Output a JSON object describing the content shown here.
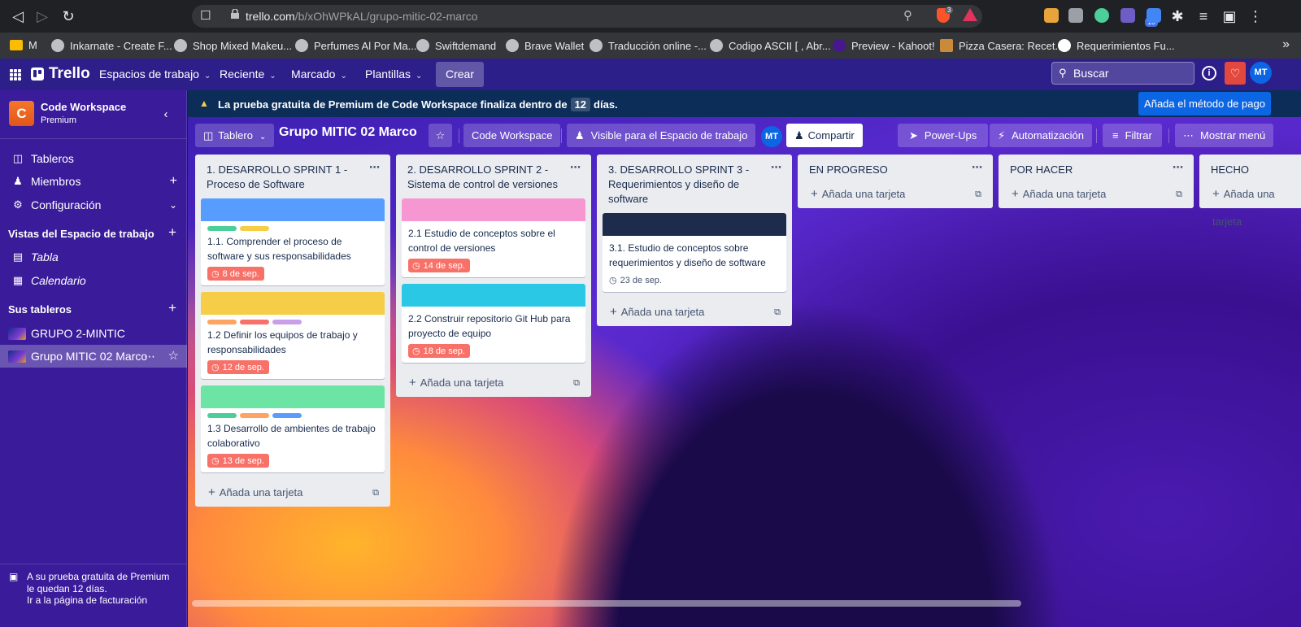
{
  "browser": {
    "url_host": "trello.com",
    "url_path": "/b/xOhWPkAL/grupo-mitic-02-marco",
    "brave_badge": "3",
    "ext_badge": "13",
    "bookmarks": [
      {
        "label": "M",
        "icon": "folder"
      },
      {
        "label": "Inkarnate - Create F...",
        "icon": "globe"
      },
      {
        "label": "Shop Mixed Makeu...",
        "icon": "globe"
      },
      {
        "label": "Perfumes Al Por Ma...",
        "icon": "globe"
      },
      {
        "label": "Swiftdemand",
        "icon": "globe"
      },
      {
        "label": "Brave Wallet",
        "icon": "globe"
      },
      {
        "label": "Traducción online -...",
        "icon": "globe"
      },
      {
        "label": "Codigo ASCII [ , Abr...",
        "icon": "globe"
      },
      {
        "label": "Preview - Kahoot!",
        "icon": "globe"
      },
      {
        "label": "Pizza Casera: Recet...",
        "icon": "globe"
      },
      {
        "label": "Requerimientos Fu...",
        "icon": "globe"
      }
    ]
  },
  "header": {
    "logo": "Trello",
    "nav": [
      "Espacios de trabajo",
      "Reciente",
      "Marcado",
      "Plantillas"
    ],
    "create": "Crear",
    "search_placeholder": "Buscar",
    "avatar": "MT"
  },
  "sidebar": {
    "workspace_initial": "C",
    "workspace_name": "Code Workspace",
    "workspace_plan": "Premium",
    "items": [
      "Tableros",
      "Miembros",
      "Configuración"
    ],
    "views_title": "Vistas del Espacio de trabajo",
    "views": [
      "Tabla",
      "Calendario"
    ],
    "boards_title": "Sus tableros",
    "boards": [
      "GRUPO 2-MINTIC",
      "Grupo MITIC 02 Marco"
    ],
    "trial_line1": "A su prueba gratuita de Premium",
    "trial_line2": "le quedan 12 días.",
    "trial_link": "Ir a la página de facturación"
  },
  "banner": {
    "text_before": "La prueba gratuita de Premium de Code Workspace finaliza dentro de",
    "days": "12",
    "text_after": "días.",
    "pay_button": "Añada el método de pago"
  },
  "board_header": {
    "view": "Tablero",
    "title": "Grupo MITIC 02 Marco",
    "workspace": "Code Workspace",
    "visibility": "Visible para el Espacio de trabajo",
    "avatar": "MT",
    "share": "Compartir",
    "powerups": "Power-Ups",
    "automation": "Automatización",
    "filter": "Filtrar",
    "menu": "Mostrar menú"
  },
  "add_card_label": "Añada una tarjeta",
  "lists": [
    {
      "title": "1. DESARROLLO SPRINT 1 - Proceso de Software",
      "cards": [
        {
          "cover": "#579dff",
          "labels": [
            "#4bce97",
            "#f5cd47"
          ],
          "title": "1.1. Comprender el proceso de software y sus responsabilidades",
          "due": "8 de sep."
        },
        {
          "cover": "#f5cd47",
          "labels": [
            "#fea362",
            "#f87168",
            "#c9a0e8"
          ],
          "title": "1.2 Definir los equipos de trabajo y responsabilidades",
          "due": "12 de sep."
        },
        {
          "cover": "#6be4a4",
          "labels": [
            "#4bce97",
            "#fea362",
            "#579dff"
          ],
          "title": "1.3 Desarrollo de ambientes de trabajo colaborativo",
          "due": "13 de sep."
        }
      ]
    },
    {
      "title": "2. DESARROLLO SPRINT 2 - Sistema de control de versiones",
      "cards": [
        {
          "cover": "#f797d2",
          "labels": [],
          "title": "2.1 Estudio de conceptos sobre el control de versiones",
          "due": "14 de sep."
        },
        {
          "cover": "#2ac8e4",
          "labels": [],
          "title": "2.2 Construir repositorio Git Hub para proyecto de equipo",
          "due": "18 de sep."
        }
      ]
    },
    {
      "title": "3. DESARROLLO SPRINT 3 - Requerimientos y diseño de software",
      "cards": [
        {
          "cover": "#1d2b4d",
          "labels": [],
          "title": "3.1. Estudio de conceptos sobre requerimientos y diseño de software",
          "due": "23 de sep.",
          "due_plain": true
        }
      ]
    },
    {
      "title": "EN PROGRESO",
      "cards": []
    },
    {
      "title": "POR HACER",
      "cards": []
    },
    {
      "title": "HECHO",
      "cards": []
    }
  ]
}
